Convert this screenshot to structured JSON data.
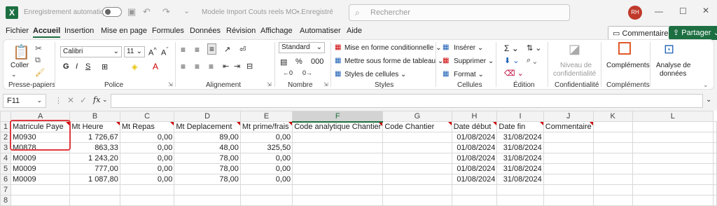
{
  "titlebar": {
    "autosave_label": "Enregistrement automatique",
    "file_title": "Modele Import Couts reels MO...",
    "saved_status": "• Enregistré",
    "search_placeholder": "Rechercher",
    "user_initials": "RH"
  },
  "menu": {
    "tabs": [
      "Fichier",
      "Accueil",
      "Insertion",
      "Mise en page",
      "Formules",
      "Données",
      "Révision",
      "Affichage",
      "Automatiser",
      "Aide"
    ],
    "comments_label": "Commentaires",
    "share_label": "Partager"
  },
  "ribbon": {
    "paste_label": "Coller",
    "clipboard_label": "Presse-papiers",
    "font_name": "Calibri",
    "font_size": "11",
    "font_group_label": "Police",
    "alignment_group_label": "Alignement",
    "number_format": "Standard",
    "number_group_label": "Nombre",
    "cond_format_label": "Mise en forme conditionnelle",
    "table_format_label": "Mettre sous forme de tableau",
    "cell_styles_label": "Styles de cellules",
    "styles_group_label": "Styles",
    "insert_label": "Insérer",
    "delete_label": "Supprimer",
    "format_label": "Format",
    "cells_group_label": "Cellules",
    "editing_group_label": "Édition",
    "sensitivity_label_1": "Niveau de",
    "sensitivity_label_2": "confidentialité",
    "sensitivity_group_label": "Confidentialité",
    "addins_label": "Compléments",
    "addins_group_label": "Compléments",
    "analyze_label_1": "Analyse de",
    "analyze_label_2": "données"
  },
  "formula_bar": {
    "name_box": "F11",
    "fx_label": "fx",
    "formula": ""
  },
  "sheet": {
    "columns": [
      "A",
      "B",
      "C",
      "D",
      "E",
      "F",
      "G",
      "H",
      "I",
      "J",
      "K",
      "L"
    ],
    "rows": [
      [
        "Matricule Paye",
        "Mt Heure",
        "Mt Repas",
        "Mt Deplacement",
        "Mt prime/frais",
        "Code analytique Chantier",
        "Code Chantier",
        "Date début",
        "Date fin",
        "Commentaire",
        "",
        ""
      ],
      [
        "M0930",
        "1 726,67",
        "0,00",
        "89,00",
        "0,00",
        "",
        "",
        "01/08/2024",
        "31/08/2024",
        "",
        "",
        ""
      ],
      [
        "M0878",
        "863,33",
        "0,00",
        "48,00",
        "325,50",
        "",
        "",
        "01/08/2024",
        "31/08/2024",
        "",
        "",
        ""
      ],
      [
        "M0009",
        "1 243,20",
        "0,00",
        "78,00",
        "0,00",
        "",
        "",
        "01/08/2024",
        "31/08/2024",
        "",
        "",
        ""
      ],
      [
        "M0009",
        "777,00",
        "0,00",
        "78,00",
        "0,00",
        "",
        "",
        "01/08/2024",
        "31/08/2024",
        "",
        "",
        ""
      ],
      [
        "M0009",
        "1 087,80",
        "0,00",
        "78,00",
        "0,00",
        "",
        "",
        "01/08/2024",
        "31/08/2024",
        "",
        "",
        ""
      ],
      [
        "",
        "",
        "",
        "",
        "",
        "",
        "",
        "",
        "",
        "",
        "",
        ""
      ],
      [
        "",
        "",
        "",
        "",
        "",
        "",
        "",
        "",
        "",
        "",
        "",
        ""
      ]
    ],
    "selected_column": "F",
    "accent_color": "#1d6f42",
    "highlight_color": "#e0393e"
  }
}
